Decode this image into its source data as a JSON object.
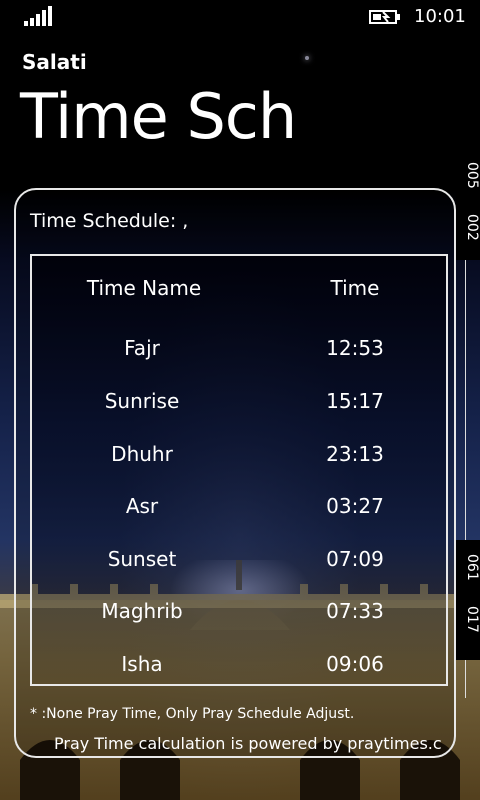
{
  "status_bar": {
    "time": "10:01",
    "signal_icon": "signal-bars-icon",
    "battery_icon": "battery-charging-icon"
  },
  "header": {
    "app_name": "Salati",
    "page_title": "Time Sch"
  },
  "card": {
    "label": "Time Schedule: ,",
    "table": {
      "columns": [
        "Time Name",
        "Time"
      ],
      "rows": [
        {
          "name": "Fajr",
          "time": "12:53"
        },
        {
          "name": "Sunrise",
          "time": "15:17"
        },
        {
          "name": "Dhuhr",
          "time": "23:13"
        },
        {
          "name": "Asr",
          "time": "03:27"
        },
        {
          "name": "Sunset",
          "time": "07:09"
        },
        {
          "name": "Maghrib",
          "time": "07:33"
        },
        {
          "name": "Isha",
          "time": "09:06"
        }
      ]
    },
    "footnote": "* :None Pray Time, Only Pray Schedule Adjust.",
    "credit": "Pray Time calculation is powered by praytimes.c"
  },
  "side_scale": {
    "labels": [
      "005",
      "002",
      "061",
      "017"
    ]
  }
}
